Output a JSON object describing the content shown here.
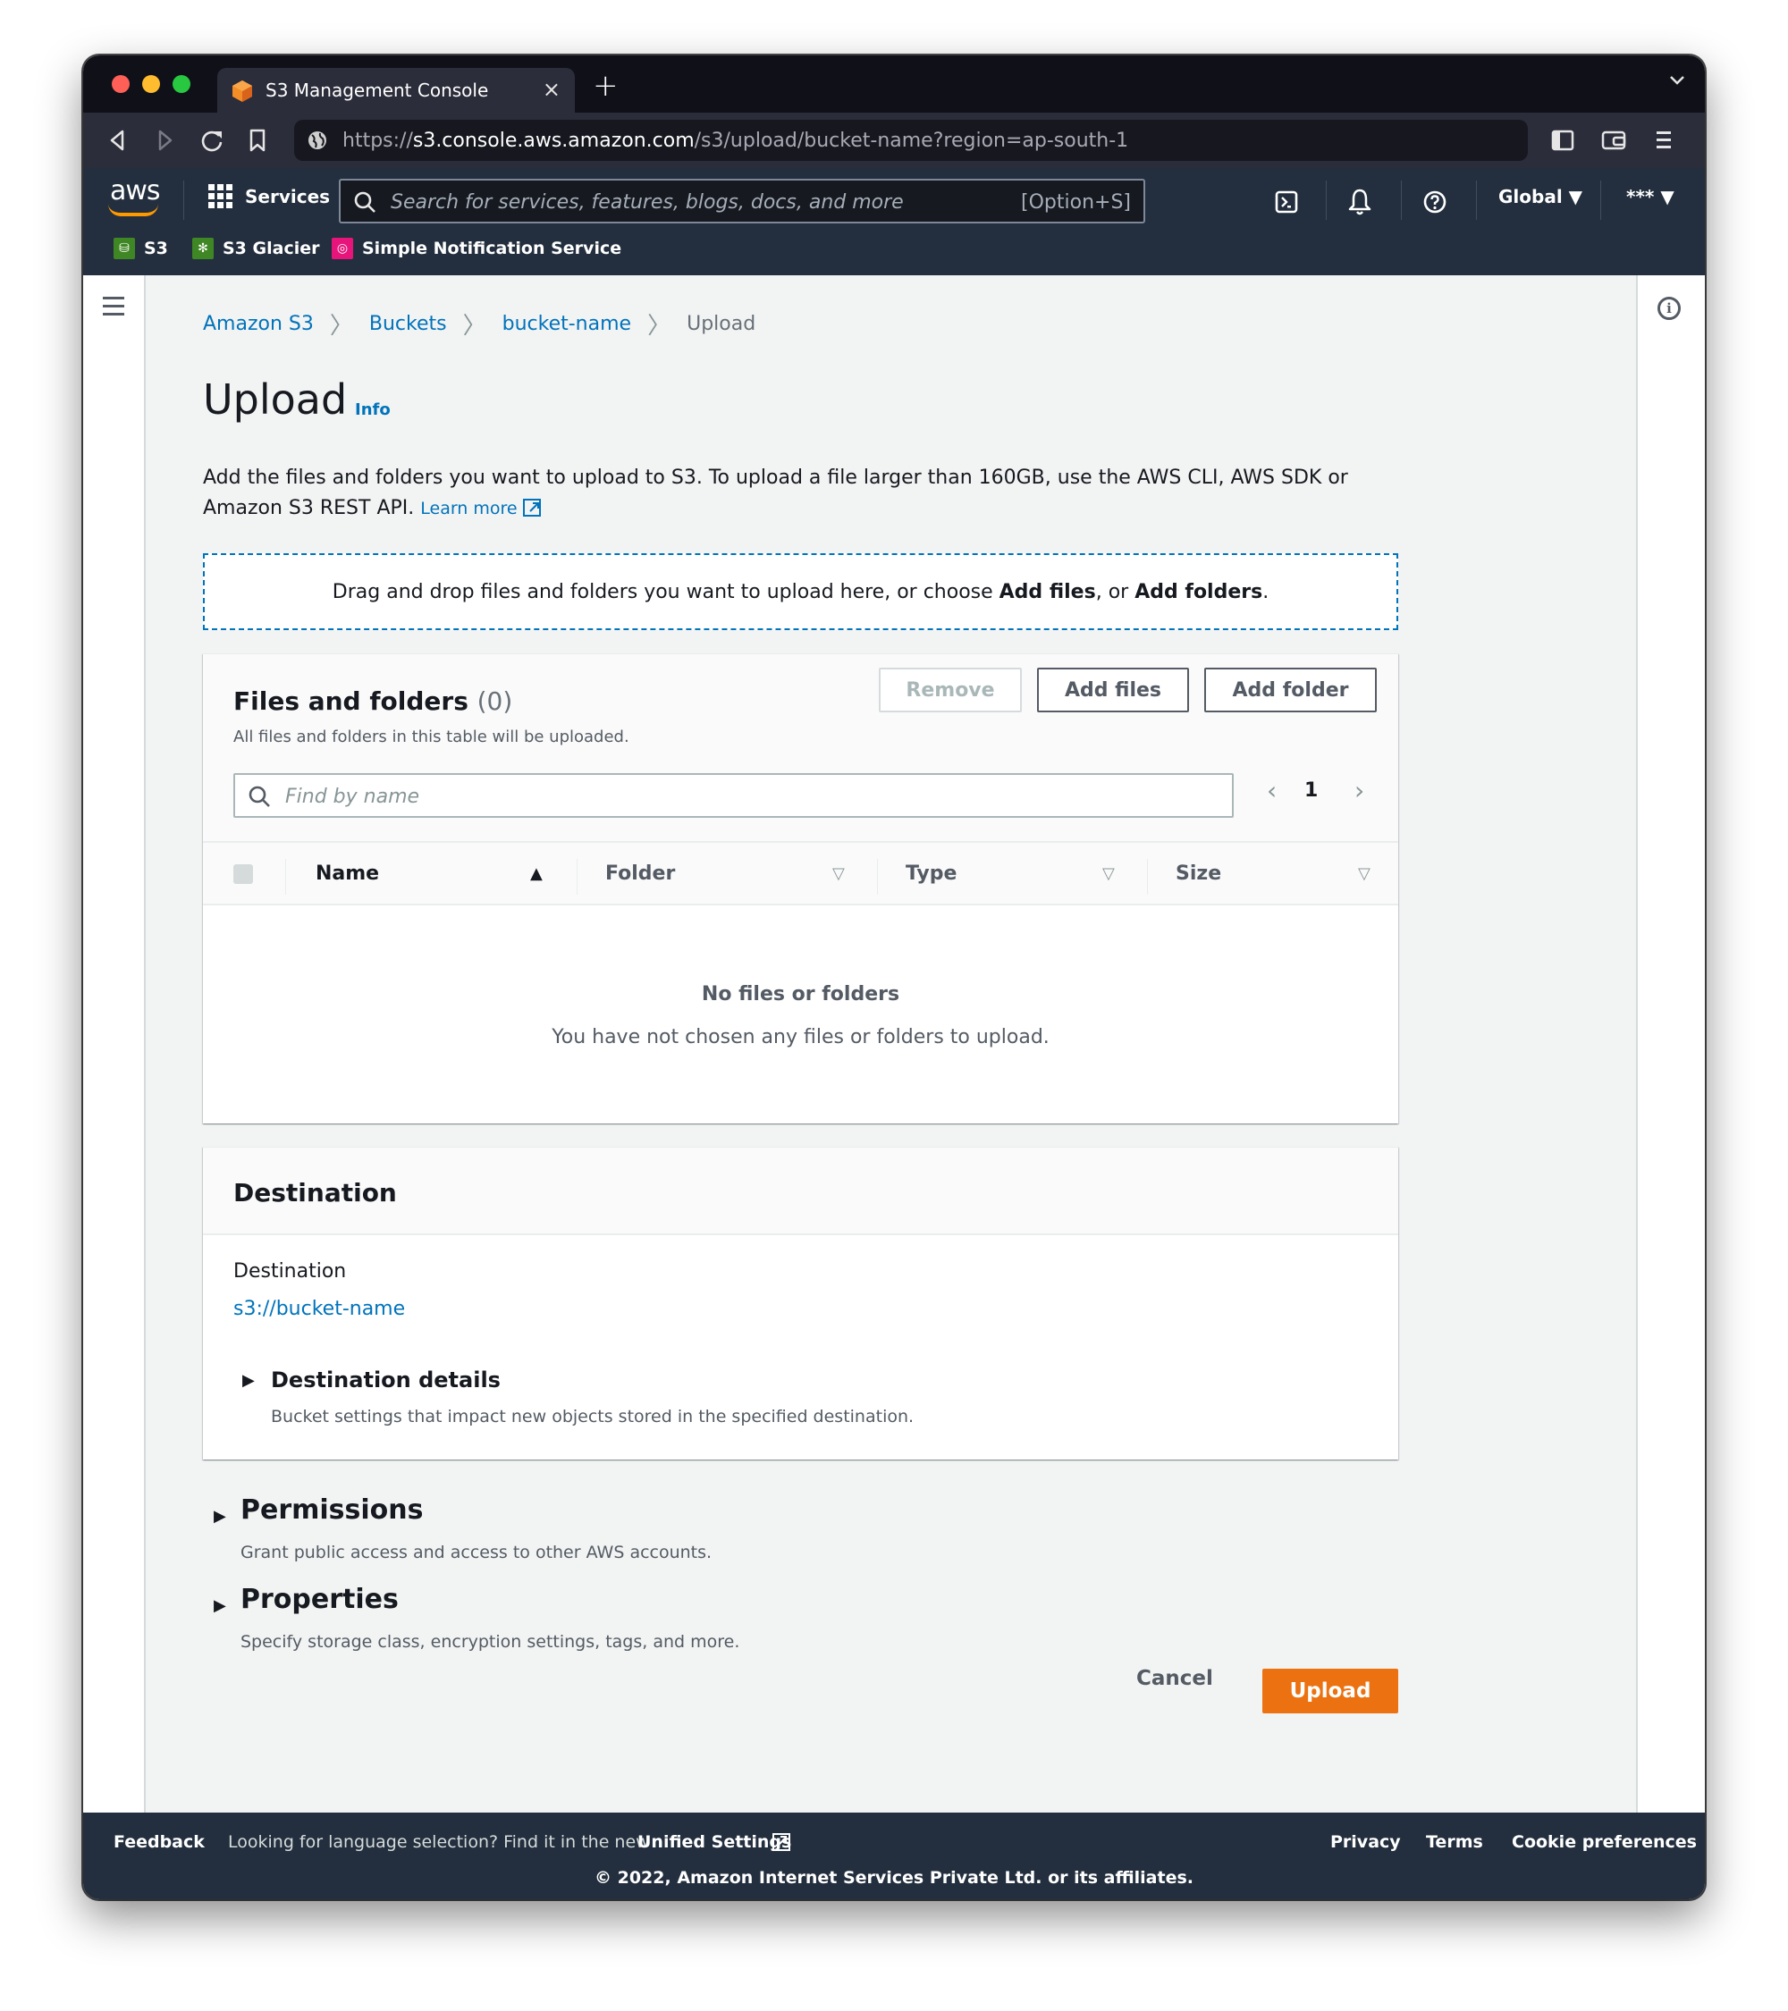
{
  "browser": {
    "tab_title": "S3 Management Console",
    "tab_close": "×",
    "new_tab": "+",
    "tab_menu": "⌄",
    "url_scheme": "https://",
    "url_host": "s3.console.aws.amazon.com",
    "url_path": "/s3/upload/bucket-name?region=ap-south-1"
  },
  "aws_nav": {
    "logo": "aws",
    "services_label": "Services",
    "search_placeholder": "Search for services, features, blogs, docs, and more",
    "search_shortcut": "[Option+S]",
    "region_label": "Global ▼",
    "account_label": "*** ▼",
    "favorites": [
      {
        "label": "S3",
        "color": "#3f8624"
      },
      {
        "label": "S3 Glacier",
        "color": "#3f8624"
      },
      {
        "label": "Simple Notification Service",
        "color": "#e7157b"
      }
    ]
  },
  "breadcrumb": {
    "items": [
      "Amazon S3",
      "Buckets",
      "bucket-name"
    ],
    "current": "Upload"
  },
  "page": {
    "title": "Upload",
    "info_link": "Info",
    "description": "Add the files and folders you want to upload to S3. To upload a file larger than 160GB, use the AWS CLI, AWS SDK or Amazon S3 REST API.",
    "learn_more": "Learn more",
    "dropzone": {
      "prefix": "Drag and drop files and folders you want to upload here, or choose ",
      "add_files": "Add files",
      "middle": ", or ",
      "add_folders": "Add folders",
      "suffix": "."
    }
  },
  "files_panel": {
    "title": "Files and folders",
    "count": "(0)",
    "subtitle": "All files and folders in this table will be uploaded.",
    "buttons": {
      "remove": "Remove",
      "add_files": "Add files",
      "add_folder": "Add folder"
    },
    "search_placeholder": "Find by name",
    "pagination": {
      "prev": "‹",
      "current_page": "1",
      "next": "›"
    },
    "columns": [
      {
        "label": "Name",
        "sort": "▲"
      },
      {
        "label": "Folder",
        "sort": "▽"
      },
      {
        "label": "Type",
        "sort": "▽"
      },
      {
        "label": "Size",
        "sort": "▽"
      }
    ],
    "empty_title": "No files or folders",
    "empty_subtitle": "You have not chosen any files or folders to upload."
  },
  "destination": {
    "header": "Destination",
    "label": "Destination",
    "value": "s3://bucket-name",
    "details_title": "Destination details",
    "details_subtitle": "Bucket settings that impact new objects stored in the specified destination."
  },
  "permissions": {
    "title": "Permissions",
    "subtitle": "Grant public access and access to other AWS accounts."
  },
  "properties": {
    "title": "Properties",
    "subtitle": "Specify storage class, encryption settings, tags, and more."
  },
  "actions": {
    "cancel": "Cancel",
    "upload": "Upload",
    "upload_color": "#ec7211"
  },
  "footer": {
    "feedback": "Feedback",
    "language_note": "Looking for language selection? Find it in the new",
    "unified_settings": "Unified Settings",
    "privacy": "Privacy",
    "terms": "Terms",
    "cookie_prefs": "Cookie preferences",
    "copyright": "© 2022, Amazon Internet Services Private Ltd. or its affiliates."
  }
}
